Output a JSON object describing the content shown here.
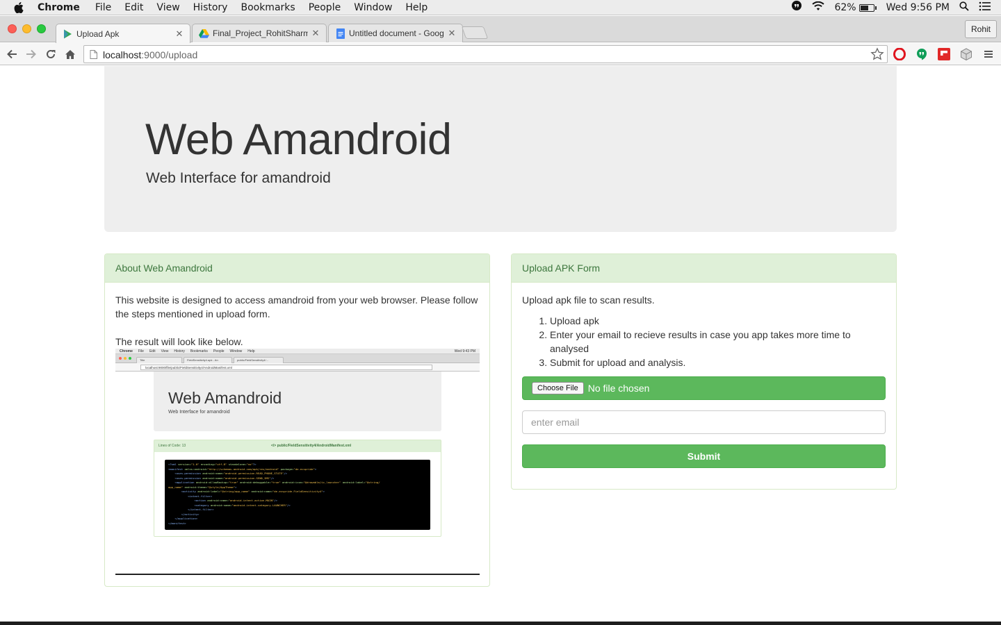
{
  "menubar": {
    "app": "Chrome",
    "items": [
      "File",
      "Edit",
      "View",
      "History",
      "Bookmarks",
      "People",
      "Window",
      "Help"
    ],
    "battery": "62%",
    "battery_level": 0.62,
    "clock": "Wed 9:56 PM"
  },
  "tabs": [
    {
      "title": "Upload Apk",
      "icon": "play-icon"
    },
    {
      "title": "Final_Project_RohitSharma",
      "icon": "drive-icon"
    },
    {
      "title": "Untitled document - Google Docs",
      "icon": "docs-icon"
    }
  ],
  "profile": "Rohit",
  "address": {
    "host": "localhost",
    "path": ":9000/upload"
  },
  "jumbotron": {
    "title": "Web Amandroid",
    "subtitle": "Web Interface for amandroid"
  },
  "about_panel": {
    "heading": "About Web Amandroid",
    "paragraph1": "This website is designed to access amandroid from your web browser. Please follow the steps mentioned in upload form.",
    "paragraph2": "The result will look like below."
  },
  "preview": {
    "menubar_items": [
      "Chrome",
      "File",
      "Edit",
      "View",
      "History",
      "Bookmarks",
      "People",
      "Window",
      "Help"
    ],
    "menubar_right": "Wed 9:43 PM",
    "tab_labels": [
      "Title",
      "FieldSensitivity4.apk - An",
      "public/FieldSensitivity4/..."
    ],
    "url": "localhost:9000/file/public/FieldSensitivity4/AndroidManifest.xml",
    "title": "Web Amandroid",
    "subtitle": "Web Interface for amandroid",
    "lines_of_code": "Lines of Code: 13",
    "file_path": "</> public/FieldSensitivity4/AndroidManifest.xml"
  },
  "upload_panel": {
    "heading": "Upload APK Form",
    "intro": "Upload apk file to scan results.",
    "steps": [
      "Upload apk",
      "Enter your email to recieve results in case you app takes more time to analysed",
      "Submit for upload and analysis."
    ],
    "choose_label": "Choose File",
    "no_file": "No file chosen",
    "email_placeholder": "enter email",
    "submit_label": "Submit"
  }
}
